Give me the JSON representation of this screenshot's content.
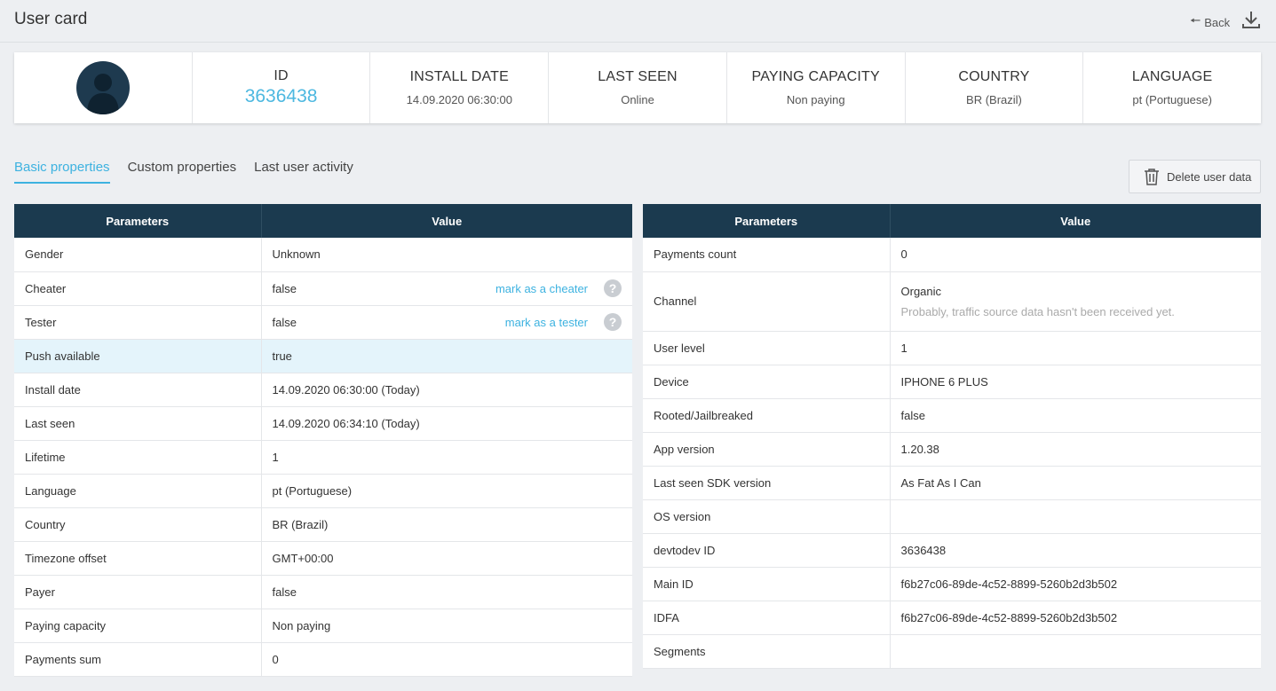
{
  "header": {
    "title": "User card",
    "back_label": "Back"
  },
  "summary": [
    {
      "label": "ID",
      "value": "3636438"
    },
    {
      "label": "INSTALL DATE",
      "value": "14.09.2020 06:30:00"
    },
    {
      "label": "LAST SEEN",
      "value": "Online"
    },
    {
      "label": "PAYING CAPACITY",
      "value": "Non paying"
    },
    {
      "label": "COUNTRY",
      "value": "BR (Brazil)"
    },
    {
      "label": "LANGUAGE",
      "value": "pt (Portuguese)"
    }
  ],
  "tabs": [
    "Basic properties",
    "Custom properties",
    "Last user activity"
  ],
  "delete_label": "Delete user data",
  "table_headers": {
    "param": "Parameters",
    "value": "Value"
  },
  "left_rows": [
    {
      "param": "Gender",
      "value": "Unknown"
    },
    {
      "param": "Cheater",
      "value": "false",
      "link": "mark as a cheater"
    },
    {
      "param": "Tester",
      "value": "false",
      "link": "mark as a tester"
    },
    {
      "param": "Push available",
      "value": "true"
    },
    {
      "param": "Install date",
      "value": "14.09.2020 06:30:00 (Today)"
    },
    {
      "param": "Last seen",
      "value": "14.09.2020 06:34:10 (Today)"
    },
    {
      "param": "Lifetime",
      "value": "1"
    },
    {
      "param": "Language",
      "value": "pt (Portuguese)"
    },
    {
      "param": "Country",
      "value": "BR (Brazil)"
    },
    {
      "param": "Timezone offset",
      "value": "GMT+00:00"
    },
    {
      "param": "Payer",
      "value": "false"
    },
    {
      "param": "Paying capacity",
      "value": "Non paying"
    },
    {
      "param": "Payments sum",
      "value": "0"
    }
  ],
  "right_rows": [
    {
      "param": "Payments count",
      "value": "0"
    },
    {
      "param": "Channel",
      "value": "Organic",
      "note": "Probably, traffic source data hasn't been received yet."
    },
    {
      "param": "User level",
      "value": "1"
    },
    {
      "param": "Device",
      "value": "IPHONE 6 PLUS"
    },
    {
      "param": "Rooted/Jailbreaked",
      "value": "false"
    },
    {
      "param": "App version",
      "value": "1.20.38"
    },
    {
      "param": "Last seen SDK version",
      "value": "As Fat As I Can"
    },
    {
      "param": "OS version",
      "value": ""
    },
    {
      "param": "devtodev ID",
      "value": "3636438"
    },
    {
      "param": "Main ID",
      "value": "f6b27c06-89de-4c52-8899-5260b2d3b502"
    },
    {
      "param": "IDFA",
      "value": "f6b27c06-89de-4c52-8899-5260b2d3b502"
    },
    {
      "param": "Segments",
      "value": ""
    }
  ],
  "help_glyph": "?"
}
